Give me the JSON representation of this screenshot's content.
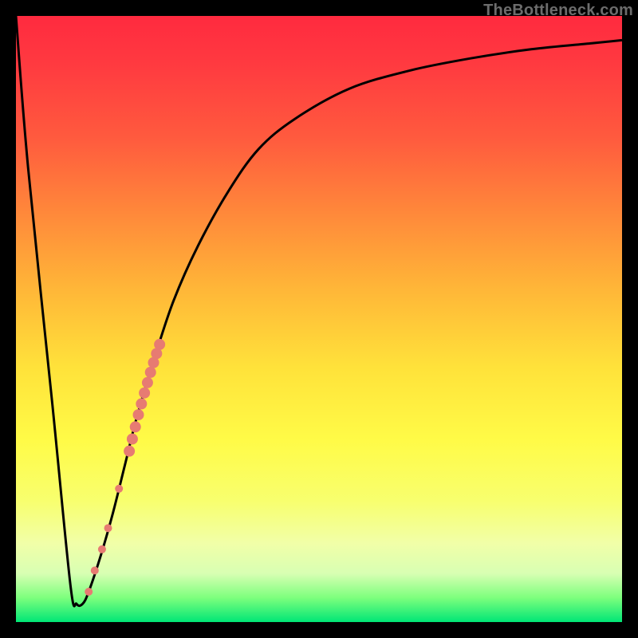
{
  "watermark": "TheBottleneck.com",
  "colors": {
    "frame": "#000000",
    "curve": "#000000",
    "marker_fill": "#e77b72",
    "marker_stroke": "#e77b72"
  },
  "chart_data": {
    "type": "line",
    "title": "",
    "xlabel": "",
    "ylabel": "",
    "xlim": [
      0,
      100
    ],
    "ylim": [
      0,
      100
    ],
    "grid": false,
    "legend": false,
    "series": [
      {
        "name": "bottleneck-curve",
        "x": [
          0,
          2,
          6,
          9,
          10,
          11,
          12,
          14,
          16,
          18,
          20,
          23,
          26,
          30,
          35,
          40,
          46,
          55,
          65,
          75,
          85,
          95,
          100
        ],
        "y": [
          100,
          75,
          36,
          6,
          3,
          3,
          5,
          11,
          18,
          26,
          34,
          44,
          53,
          62,
          71,
          78,
          83,
          88,
          91,
          93,
          94.5,
          95.5,
          96
        ]
      }
    ],
    "markers": [
      {
        "x": 12.0,
        "y": 5.0,
        "r": 5
      },
      {
        "x": 13.0,
        "y": 8.5,
        "r": 5
      },
      {
        "x": 14.2,
        "y": 12.0,
        "r": 5
      },
      {
        "x": 15.2,
        "y": 15.5,
        "r": 5
      },
      {
        "x": 17.0,
        "y": 22.0,
        "r": 5
      },
      {
        "x": 18.7,
        "y": 28.2,
        "r": 7
      },
      {
        "x": 19.2,
        "y": 30.2,
        "r": 7
      },
      {
        "x": 19.7,
        "y": 32.2,
        "r": 7
      },
      {
        "x": 20.2,
        "y": 34.2,
        "r": 7
      },
      {
        "x": 20.7,
        "y": 36.0,
        "r": 7
      },
      {
        "x": 21.2,
        "y": 37.8,
        "r": 7
      },
      {
        "x": 21.7,
        "y": 39.5,
        "r": 7
      },
      {
        "x": 22.2,
        "y": 41.2,
        "r": 7
      },
      {
        "x": 22.7,
        "y": 42.8,
        "r": 7
      },
      {
        "x": 23.2,
        "y": 44.3,
        "r": 7
      },
      {
        "x": 23.7,
        "y": 45.8,
        "r": 7
      }
    ]
  }
}
